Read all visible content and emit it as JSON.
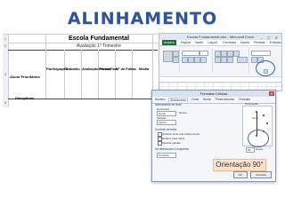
{
  "slide": {
    "title": "ALINHAMENTO"
  },
  "sheet": {
    "row_numbers": [
      "1",
      "2",
      "3",
      "4"
    ],
    "title": "Escola Fundamental",
    "subtitle": "Avaliação 1º Trimestre",
    "labels": [
      "Aluno Prioritários",
      "Disciplinas"
    ],
    "column_headers": [
      "Participação",
      "Trabalho",
      "Avaliação Parcial",
      "Prova Final",
      "Nº de Faltas",
      "Média"
    ]
  },
  "excel": {
    "title": "Escola Fundamental.xlsx - Microsoft Excel",
    "tabs": [
      "Arquivo",
      "Página Inicial",
      "Inserir",
      "Layout da Página",
      "Fórmulas",
      "Dados",
      "Revisão",
      "Exibição"
    ]
  },
  "dialog": {
    "title": "Formatar Células",
    "tabs": [
      "Número",
      "Alinhamento",
      "Fonte",
      "Borda",
      "Preenchimento",
      "Proteção"
    ],
    "sections": {
      "alignment": "Alinhamento de texto",
      "horizontal": "Horizontal:",
      "vertical": "Vertical:",
      "text_control": "Controle de texto",
      "rtl": "Da direita para a esquerda",
      "orientation": "Orientação"
    },
    "checkboxes": [
      "Quebrar texto automaticamente",
      "Reduzir para caber",
      "Mesclar células"
    ],
    "values": {
      "horizontal": "Geral",
      "vertical": "Inferior",
      "direction": "Contexto",
      "degrees": "90",
      "degrees_label": "Graus",
      "indent_label": "Recuo:"
    },
    "orientation_text": "Texto",
    "buttons": [
      "OK",
      "Cancelar"
    ]
  },
  "callout": {
    "text": "Orientação  90°"
  },
  "colors": {
    "title": "#2f5597",
    "highlight_circle": "#3a63c2",
    "callout_bg": "#fbe3d0",
    "excel_file_tab": "#1f6b3a"
  }
}
